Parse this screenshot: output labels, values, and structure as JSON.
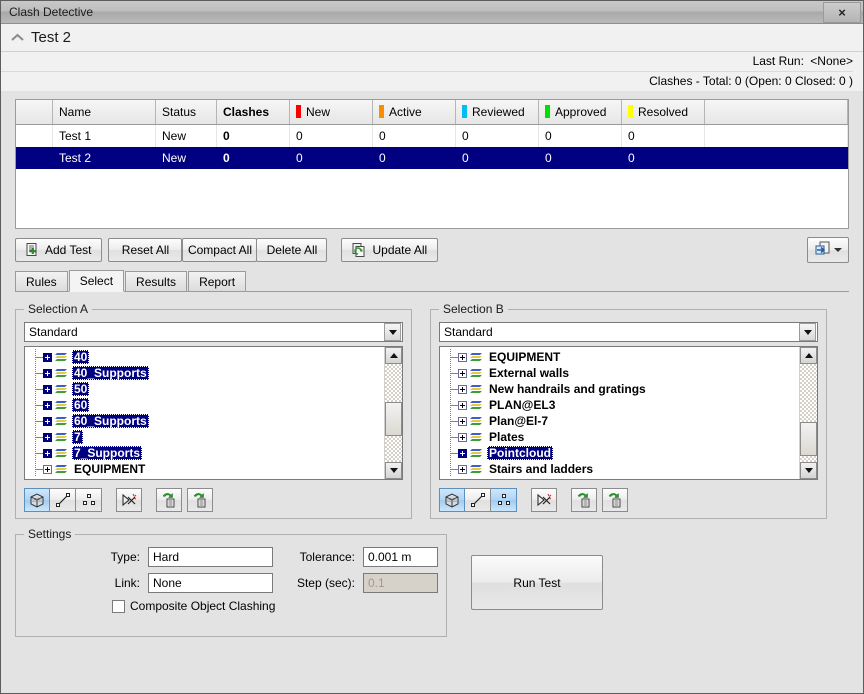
{
  "window": {
    "title": "Clash Detective",
    "close_label": "×"
  },
  "header": {
    "collapse_icon": "chevron-up-icon",
    "test_name": "Test 2",
    "last_run_label": "Last Run:",
    "last_run_value": "<None>",
    "clashes_summary": "Clashes - Total: 0  (Open: 0  Closed: 0 )"
  },
  "grid": {
    "columns": [
      "",
      "Name",
      "Status",
      "Clashes",
      "New",
      "Active",
      "Reviewed",
      "Approved",
      "Resolved",
      ""
    ],
    "column_swatches": {
      "New": "#ff0000",
      "Active": "#ff8c00",
      "Reviewed": "#00bfee",
      "Approved": "#00e000",
      "Resolved": "#ffff00"
    },
    "rows": [
      {
        "name": "Test 1",
        "status": "New",
        "clashes": "0",
        "new": "0",
        "active": "0",
        "reviewed": "0",
        "approved": "0",
        "resolved": "0",
        "selected": false
      },
      {
        "name": "Test 2",
        "status": "New",
        "clashes": "0",
        "new": "0",
        "active": "0",
        "reviewed": "0",
        "approved": "0",
        "resolved": "0",
        "selected": true
      }
    ]
  },
  "toolbar": {
    "add_test": "Add Test",
    "reset_all": "Reset All",
    "compact_all": "Compact All",
    "delete_all": "Delete All",
    "update_all": "Update All",
    "export_icon": "import-export-icon"
  },
  "tabs": [
    {
      "label": "Rules",
      "active": false
    },
    {
      "label": "Select",
      "active": true
    },
    {
      "label": "Results",
      "active": false
    },
    {
      "label": "Report",
      "active": false
    }
  ],
  "selection_a": {
    "legend": "Selection A",
    "combo_value": "Standard",
    "tree_items": [
      {
        "label": "40",
        "selected": true
      },
      {
        "label": "40_Supports",
        "selected": true
      },
      {
        "label": "50",
        "selected": true
      },
      {
        "label": "60",
        "selected": true
      },
      {
        "label": "60_Supports",
        "selected": true
      },
      {
        "label": "7",
        "selected": true
      },
      {
        "label": "7_Supports",
        "selected": true
      },
      {
        "label": "EQUIPMENT",
        "selected": false
      }
    ],
    "scroll_thumb_pct": 38,
    "mode_buttons": [
      {
        "name": "select-geometry-button",
        "active": true
      },
      {
        "name": "select-line-button",
        "active": false
      },
      {
        "name": "select-points-button",
        "active": false
      }
    ],
    "clear_button": "clear-selection-button",
    "extra_buttons": [
      "add-selection-to-set-button",
      "update-selection-from-set-button"
    ]
  },
  "selection_b": {
    "legend": "Selection B",
    "combo_value": "Standard",
    "tree_items": [
      {
        "label": "EQUIPMENT",
        "selected": false
      },
      {
        "label": "External walls",
        "selected": false
      },
      {
        "label": "New handrails and gratings",
        "selected": false
      },
      {
        "label": "PLAN@EL3",
        "selected": false
      },
      {
        "label": "Plan@El-7",
        "selected": false
      },
      {
        "label": "Plates",
        "selected": false
      },
      {
        "label": "Pointcloud",
        "selected": true
      },
      {
        "label": "Stairs and ladders",
        "selected": false
      }
    ],
    "scroll_thumb_pct": 62,
    "mode_buttons": [
      {
        "name": "select-geometry-button",
        "active": true
      },
      {
        "name": "select-line-button",
        "active": false
      },
      {
        "name": "select-points-button",
        "active": true
      }
    ],
    "clear_button": "clear-selection-button",
    "extra_buttons": [
      "add-selection-to-set-button",
      "update-selection-from-set-button"
    ]
  },
  "settings": {
    "legend": "Settings",
    "type_label": "Type:",
    "type_value": "Hard",
    "tolerance_label": "Tolerance:",
    "tolerance_value": "0.001 m",
    "link_label": "Link:",
    "link_value": "None",
    "step_label": "Step (sec):",
    "step_value": "0.1",
    "step_disabled": true,
    "composite_label": "Composite Object Clashing",
    "composite_checked": false
  },
  "run": {
    "label": "Run Test"
  }
}
